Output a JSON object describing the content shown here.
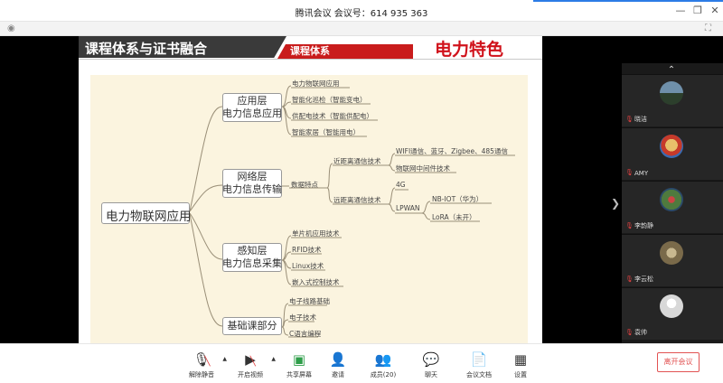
{
  "window": {
    "title": "腾讯会议 会议号：614 935 363",
    "minimize_glyph": "—",
    "restore_glyph": "❐",
    "close_glyph": "✕",
    "accent_color": "#2c7ce6"
  },
  "slide": {
    "header_title": "课程体系与证书融合",
    "header_tag": "课程体系",
    "header_highlight": "电力特色",
    "mindmap": {
      "root": "电力物联网应用",
      "branches": [
        {
          "label_line1": "应用层",
          "label_line2": "电力信息应用",
          "children": [
            "电力物联网应用",
            "智能化巡检（智能变电）",
            "供配电技术（智能供配电）",
            "智能家居（智能用电）"
          ]
        },
        {
          "label_line1": "网络层",
          "label_line2": "电力信息传输",
          "child": "数据特点",
          "groups": [
            {
              "label": "近距离通信技术",
              "children": [
                "WIFI通信、蓝牙、Zigbee、485通信",
                "物联网中间件技术"
              ]
            },
            {
              "label": "远距离通信技术",
              "children": [
                "4G",
                "LPWAN"
              ],
              "lpwan_children": [
                "NB-IOT（华为）",
                "LoRA（未开）"
              ]
            }
          ]
        },
        {
          "label_line1": "感知层",
          "label_line2": "电力信息采集",
          "children": [
            "单片机应用技术",
            "RFID技术",
            "Linux技术",
            "嵌入式控制技术"
          ]
        },
        {
          "label_line1": "基础课部分",
          "children": [
            "电子线路基础",
            "电子技术",
            "C语言编程"
          ]
        }
      ]
    }
  },
  "participants": [
    {
      "name": "晓洁",
      "avatar_color": "#4b6a84"
    },
    {
      "name": "AMY",
      "avatar_color": "#d9962a"
    },
    {
      "name": "李韵静",
      "avatar_color": "#5a7a46"
    },
    {
      "name": "李云松",
      "avatar_color": "#8b7a5a"
    },
    {
      "name": "袁帅",
      "avatar_color": "#d8d8d8"
    }
  ],
  "toolbar": {
    "unmute": "解除静音",
    "start_video": "开启视频",
    "share_screen": "共享屏幕",
    "invite": "邀请",
    "members": "成员(20)",
    "chat": "聊天",
    "docs": "会议文档",
    "settings": "设置",
    "leave": "离开会议"
  }
}
